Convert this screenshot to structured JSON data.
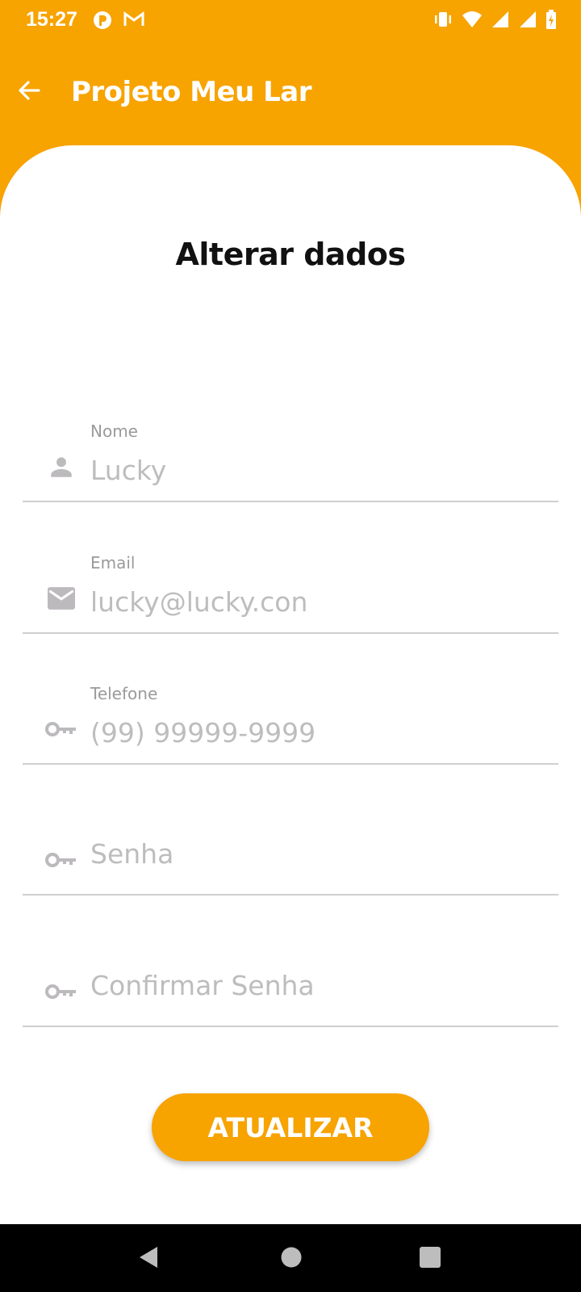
{
  "status_bar": {
    "time": "15:27",
    "left_icons": [
      "app-notification-icon",
      "gmail-icon"
    ],
    "right_icons": [
      "vibrate-icon",
      "wifi-icon",
      "signal-icon",
      "signal-icon",
      "battery-charging-icon"
    ]
  },
  "app_bar": {
    "title": "Projeto Meu Lar",
    "back_icon": "arrow-back-icon"
  },
  "page": {
    "title": "Alterar dados"
  },
  "form": {
    "fields": [
      {
        "label": "Nome",
        "value": "Lucky",
        "icon": "person-icon"
      },
      {
        "label": "Email",
        "value": "lucky@lucky.con",
        "icon": "mail-icon"
      },
      {
        "label": "Telefone",
        "value": "(99) 99999-9999",
        "icon": "key-icon"
      },
      {
        "label": "",
        "placeholder": "Senha",
        "icon": "key-icon"
      },
      {
        "label": "",
        "placeholder": "Confirmar Senha",
        "icon": "key-icon"
      }
    ],
    "submit_label": "ATUALIZAR"
  },
  "nav_bar": {
    "icons": [
      "nav-back-icon",
      "nav-home-icon",
      "nav-recents-icon"
    ]
  },
  "colors": {
    "accent": "#F7A300",
    "card": "#FFFFFF",
    "hint_text": "#BDBDBD",
    "label_text": "#9A9A9A",
    "icon": "#BDBABE"
  }
}
